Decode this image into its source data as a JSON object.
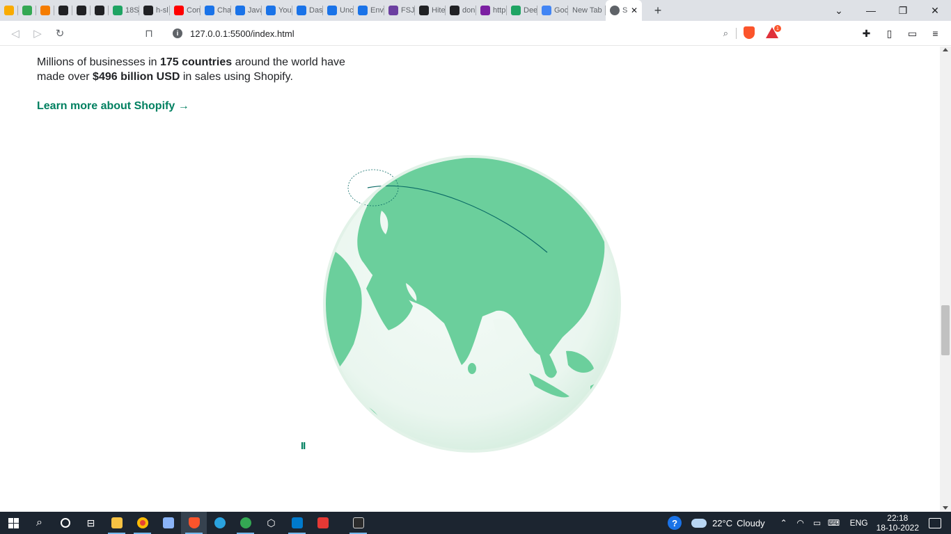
{
  "browser": {
    "tabs": [
      {
        "label": "",
        "color": "#f9ab00"
      },
      {
        "label": "",
        "color": "#34a853"
      },
      {
        "label": "",
        "color": "#f57c00"
      },
      {
        "label": "",
        "color": "#202124"
      },
      {
        "label": "",
        "color": "#202124"
      },
      {
        "label": "",
        "color": "#202124"
      },
      {
        "label": "18S",
        "color": "#1fa463"
      },
      {
        "label": "h-sl",
        "color": "#202124"
      },
      {
        "label": "Con",
        "color": "#ff0000"
      },
      {
        "label": "Cha",
        "color": "#1a73e8"
      },
      {
        "label": "Java",
        "color": "#1a73e8"
      },
      {
        "label": "You",
        "color": "#1a73e8"
      },
      {
        "label": "Das",
        "color": "#1a73e8"
      },
      {
        "label": "Unc",
        "color": "#1a73e8"
      },
      {
        "label": "Env",
        "color": "#1a73e8"
      },
      {
        "label": "FSJS",
        "color": "#6b3fa0"
      },
      {
        "label": "Hite",
        "color": "#202124"
      },
      {
        "label": "don",
        "color": "#202124"
      },
      {
        "label": "http",
        "color": "#7b1fa2"
      },
      {
        "label": "Dee",
        "color": "#1fa463"
      },
      {
        "label": "Goc",
        "color": "#4285f4"
      },
      {
        "label": "New Tab",
        "color": ""
      }
    ],
    "active_tab_label": "S",
    "new_tab_label": "+",
    "address": "127.0.0.1:5500/index.html",
    "rewards_badge": "1"
  },
  "page": {
    "stats_pre": "Millions of businesses in ",
    "stats_countries": "175 countries",
    "stats_mid": " around the world have made over ",
    "stats_sales": "$496 billion USD",
    "stats_post": " in sales using Shopify.",
    "learn_more": "Learn more about Shopify →",
    "pause_label": "II",
    "colors": {
      "brand": "#008060",
      "land": "#6bcf9c",
      "ocean": "#eef8f2"
    }
  },
  "taskbar": {
    "weather_temp": "22°C",
    "weather_desc": "Cloudy",
    "language": "ENG",
    "time": "22:18",
    "date": "18-10-2022"
  }
}
